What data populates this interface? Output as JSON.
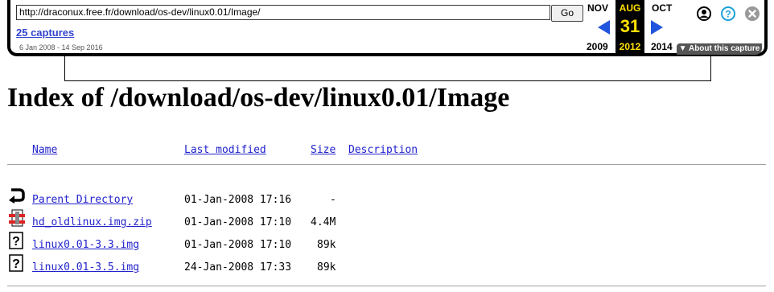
{
  "toolbar": {
    "url": "http://draconux.free.fr/download/os-dev/linux0.01/Image/",
    "go_label": "Go",
    "captures_label": "25 captures",
    "captures_range": "6 Jan 2008 - 14 Sep 2016",
    "prev_month": "NOV",
    "prev_year": "2009",
    "current_month": "AUG",
    "current_day": "31",
    "current_year": "2012",
    "next_month": "OCT",
    "next_year": "2014",
    "about_label": "▼ About this capture",
    "icons": [
      "user-icon",
      "help-icon",
      "close-icon"
    ],
    "colors": {
      "accent": "#2255dd",
      "current_highlight": "#ffe000",
      "link": "#3344cc"
    }
  },
  "listing": {
    "title": "Index of /download/os-dev/linux0.01/Image",
    "columns": [
      "Name",
      "Last modified",
      "Size",
      "Description"
    ],
    "rows": [
      {
        "icon": "back-icon",
        "name": "Parent Directory",
        "modified": "01-Jan-2008 17:16",
        "size": "-",
        "description": ""
      },
      {
        "icon": "compressed-file-icon",
        "name": "hd_oldlinux.img.zip",
        "modified": "01-Jan-2008 17:10",
        "size": "4.4M",
        "description": ""
      },
      {
        "icon": "unknown-file-icon",
        "name": "linux0.01-3.3.img",
        "modified": "01-Jan-2008 17:10",
        "size": "89k",
        "description": ""
      },
      {
        "icon": "unknown-file-icon",
        "name": "linux0.01-3.5.img",
        "modified": "24-Jan-2008 17:33",
        "size": "89k",
        "description": ""
      }
    ]
  }
}
